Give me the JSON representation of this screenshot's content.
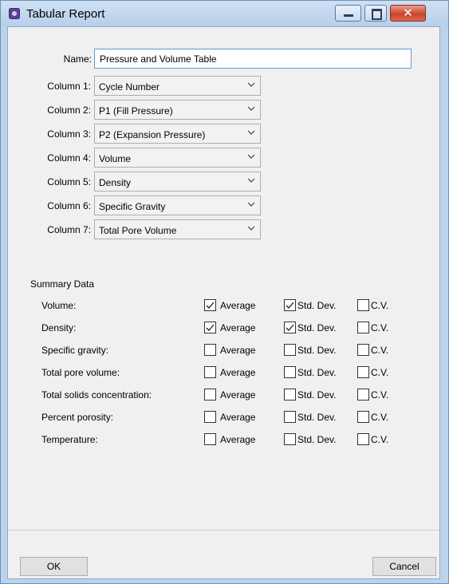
{
  "window": {
    "title": "Tabular Report",
    "icon": "app-icon",
    "close_glyph": "✕"
  },
  "form": {
    "name_label": "Name:",
    "name_value": "Pressure and Volume Table",
    "columns": [
      {
        "label": "Column 1:",
        "value": "Cycle Number"
      },
      {
        "label": "Column 2:",
        "value": "P1 (Fill Pressure)"
      },
      {
        "label": "Column 3:",
        "value": "P2 (Expansion Pressure)"
      },
      {
        "label": "Column 4:",
        "value": "Volume"
      },
      {
        "label": "Column 5:",
        "value": "Density"
      },
      {
        "label": "Column 6:",
        "value": "Specific Gravity"
      },
      {
        "label": "Column 7:",
        "value": "Total Pore Volume"
      }
    ]
  },
  "summary": {
    "title": "Summary Data",
    "option_labels": {
      "average": "Average",
      "std_dev": "Std. Dev.",
      "cv": "C.V."
    },
    "rows": [
      {
        "label": "Volume:",
        "average": true,
        "std_dev": true,
        "cv": false
      },
      {
        "label": "Density:",
        "average": true,
        "std_dev": true,
        "cv": false
      },
      {
        "label": "Specific gravity:",
        "average": false,
        "std_dev": false,
        "cv": false
      },
      {
        "label": "Total pore volume:",
        "average": false,
        "std_dev": false,
        "cv": false
      },
      {
        "label": "Total solids concentration:",
        "average": false,
        "std_dev": false,
        "cv": false
      },
      {
        "label": "Percent porosity:",
        "average": false,
        "std_dev": false,
        "cv": false
      },
      {
        "label": "Temperature:",
        "average": false,
        "std_dev": false,
        "cv": false
      }
    ]
  },
  "buttons": {
    "ok": "OK",
    "cancel": "Cancel"
  }
}
